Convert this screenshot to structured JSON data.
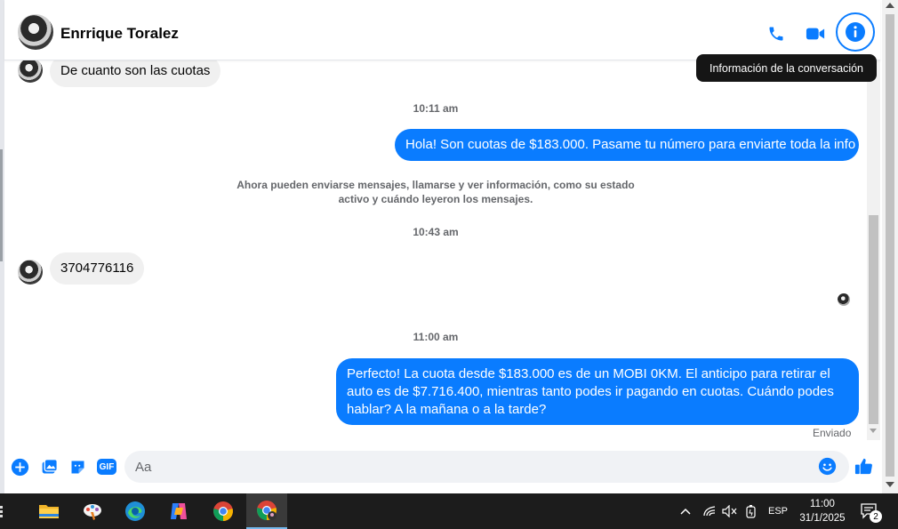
{
  "contact": {
    "name": "Enrrique Toralez"
  },
  "header": {
    "tooltip": "Información de la conversación"
  },
  "messages": {
    "m1": "De cuanto son las cuotas",
    "t1": "10:11 am",
    "m2": "Hola! Son cuotas de $183.000. Pasame tu número para enviarte toda la info",
    "note": "Ahora pueden enviarse mensajes, llamarse y ver información, como su estado activo y cuándo leyeron los mensajes.",
    "t2": "10:43 am",
    "m3": "3704776116",
    "t3": "11:00 am",
    "m4": "Perfecto! La cuota desde $183.000 es de un MOBI 0KM. El anticipo para retirar el auto es de $7.716.400, mientras tanto podes ir pagando en cuotas. Cuándo podes hablar? A la mañana o a la tarde?",
    "status": "Enviado"
  },
  "composer": {
    "placeholder": "Aa",
    "gif_label": "GIF"
  },
  "taskbar": {
    "language": "ESP",
    "time": "11:00",
    "date": "31/1/2025",
    "notification_count": "2"
  },
  "colors": {
    "accent": "#0a7cff",
    "bubble_in": "#f0f0f0",
    "taskbar": "#1c1c1c"
  }
}
